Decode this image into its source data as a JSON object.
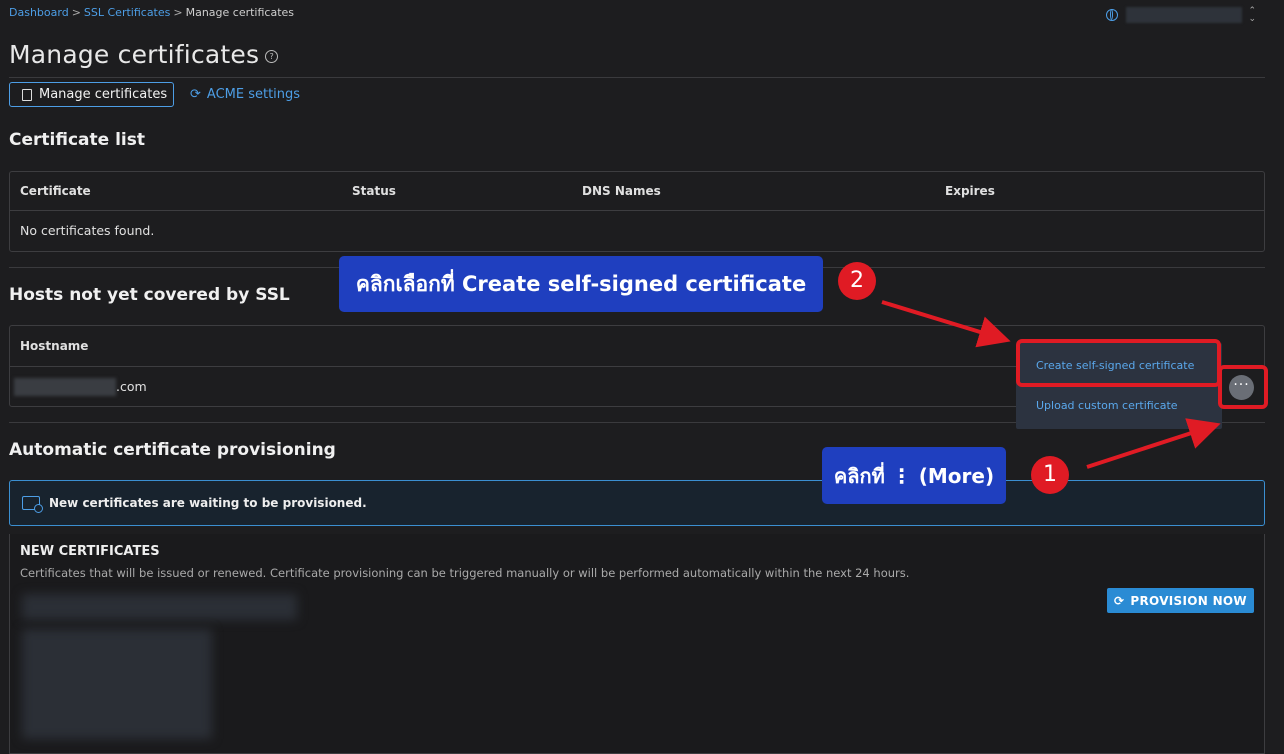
{
  "breadcrumb": {
    "dashboard": "Dashboard",
    "ssl": "SSL Certificates",
    "current": "Manage certificates"
  },
  "page_title": "Manage certificates",
  "help_glyph": "?",
  "tabs": {
    "manage": "Manage certificates",
    "acme": "ACME settings"
  },
  "certificate_list": {
    "title": "Certificate list",
    "columns": [
      "Certificate",
      "Status",
      "DNS Names",
      "Expires"
    ],
    "empty": "No certificates found."
  },
  "hosts": {
    "title": "Hosts not yet covered by SSL",
    "column": "Hostname",
    "row_suffix": ".com"
  },
  "dropdown": {
    "create": "Create self-signed certificate",
    "upload": "Upload custom certificate"
  },
  "more_glyph": "···",
  "provisioning": {
    "title": "Automatic certificate provisioning",
    "alert": "New certificates are waiting to be provisioned.",
    "panel_title": "NEW CERTIFICATES",
    "panel_desc": "Certificates that will be issued or renewed. Certificate provisioning can be triggered manually or will be performed automatically within the next 24 hours.",
    "button": "PROVISION NOW"
  },
  "annotations": {
    "callout2": "คลิกเลือกที่ Create self-signed certificate",
    "step2": "2",
    "callout1": "คลิกที่ ⋮ (More)",
    "step1": "1"
  },
  "colors": {
    "accent": "#4d9ee6",
    "annotation_red": "#e01b24",
    "callout_blue": "#1f3fbf",
    "button_blue": "#2a8bd4"
  }
}
